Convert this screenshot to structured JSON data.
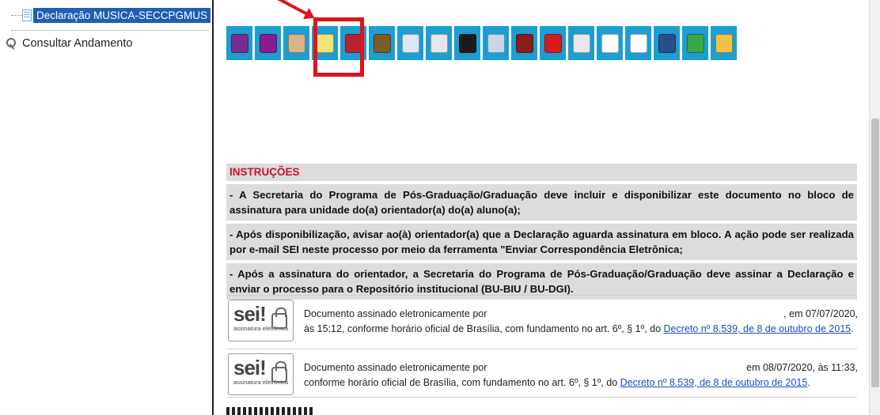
{
  "tree": {
    "selected_item": "Declaração MUSICA-SECCPGMUS",
    "consult_label": "Consultar Andamento"
  },
  "toolbar": {
    "buttons": [
      {
        "icon": "people-icon",
        "color": "#7a2c8c"
      },
      {
        "icon": "eye-icon",
        "color": "#8a1c8c"
      },
      {
        "icon": "hand-icon",
        "color": "#d9b48a"
      },
      {
        "icon": "envelope-document-icon",
        "color": "#f0e37a"
      },
      {
        "icon": "stamp-icon",
        "color": "#b5242c"
      },
      {
        "icon": "scroll-edit-icon",
        "color": "#7d5a2a"
      },
      {
        "icon": "email-icon",
        "color": "#dbe8f3"
      },
      {
        "icon": "document-list-icon",
        "color": "#e6e6e6"
      },
      {
        "icon": "pen-icon",
        "color": "#1b1b1b"
      },
      {
        "icon": "sign-document-icon",
        "color": "#c9d6e6"
      },
      {
        "icon": "books-icon",
        "color": "#8a1c1c"
      },
      {
        "icon": "cancel-icon",
        "color": "#d71920"
      },
      {
        "icon": "favorite-document-icon",
        "color": "#e8e8e8"
      },
      {
        "icon": "copy-documents-icon",
        "color": "#ffffff"
      },
      {
        "icon": "version-icon",
        "color": "#ffffff"
      },
      {
        "icon": "print-globe-icon",
        "color": "#2b4e8a"
      },
      {
        "icon": "recycle-bin-icon",
        "color": "#39a84a"
      },
      {
        "icon": "delete-document-icon",
        "color": "#f0c24a"
      }
    ]
  },
  "instructions": {
    "heading": "INSTRUÇÕES",
    "items": [
      "- A Secretaria do Programa de Pós-Graduação/Graduação deve incluir e disponibilizar este documento no bloco de assinatura para unidade do(a) orientador(a) do(a) aluno(a);",
      "- Após disponibilização, avisar ao(à) orientador(a) que a Declaração aguarda assinatura em bloco. A ação pode ser realizada por e-mail SEI neste processo por meio da ferramenta \"Enviar Correspondência Eletrônica;",
      "- Após a assinatura do orientador, a Secretaria do Programa de Pós-Graduação/Graduação deve assinar a Declaração e enviar o processo para o Repositório institucional (BU-BIU / BU-DGI)."
    ]
  },
  "signatures": [
    {
      "seal_title": "sei!",
      "seal_sub": "assinatura eletrônica",
      "line1_start": "Documento assinado eletronicamente por",
      "line1_end": ", em 07/07/2020,",
      "line2": "às 15:12, conforme horário oficial de Brasília, com fundamento no art. 6º, § 1º, do ",
      "link": "Decreto nº 8.539, de 8 de outubro de 2015",
      "tail": "."
    },
    {
      "seal_title": "sei!",
      "seal_sub": "assinatura eletrônica",
      "line1_start": "Documento assinado eletronicamente por",
      "line1_end": "em 08/07/2020, às 11:33,",
      "line2": "conforme horário oficial de Brasília, com fundamento no art. 6º, § 1º, do ",
      "link": "Decreto nº 8.539, de 8 de outubro de 2015",
      "tail": "."
    }
  ]
}
